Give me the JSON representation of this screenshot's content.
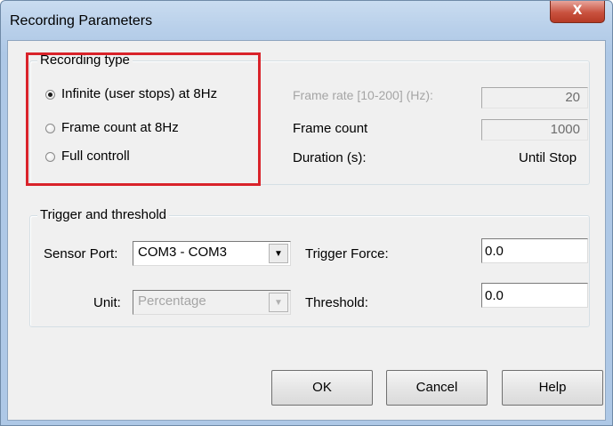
{
  "window": {
    "title": "Recording Parameters",
    "close_glyph": "X"
  },
  "recording_type": {
    "group_label": "Recording type",
    "options": [
      {
        "label": "Infinite (user stops) at 8Hz",
        "selected": true
      },
      {
        "label": "Frame count at 8Hz",
        "selected": false
      },
      {
        "label": "Full controll",
        "selected": false
      }
    ],
    "frame_rate_label": "Frame rate [10-200] (Hz):",
    "frame_rate_value": "20",
    "frame_count_label": "Frame count",
    "frame_count_value": "1000",
    "duration_label": "Duration (s):",
    "duration_value": "Until Stop"
  },
  "trigger": {
    "group_label": "Trigger and threshold",
    "sensor_port_label": "Sensor Port:",
    "sensor_port_value": "COM3 - COM3",
    "unit_label": "Unit:",
    "unit_value": "Percentage",
    "trigger_force_label": "Trigger Force:",
    "trigger_force_value": "0.0",
    "threshold_label": "Threshold:",
    "threshold_value": "0.0"
  },
  "buttons": {
    "ok": "OK",
    "cancel": "Cancel",
    "help": "Help"
  },
  "icons": {
    "dropdown_arrow": "▼"
  },
  "colors": {
    "highlight": "#d9232a",
    "close_button": "#c9523f"
  }
}
